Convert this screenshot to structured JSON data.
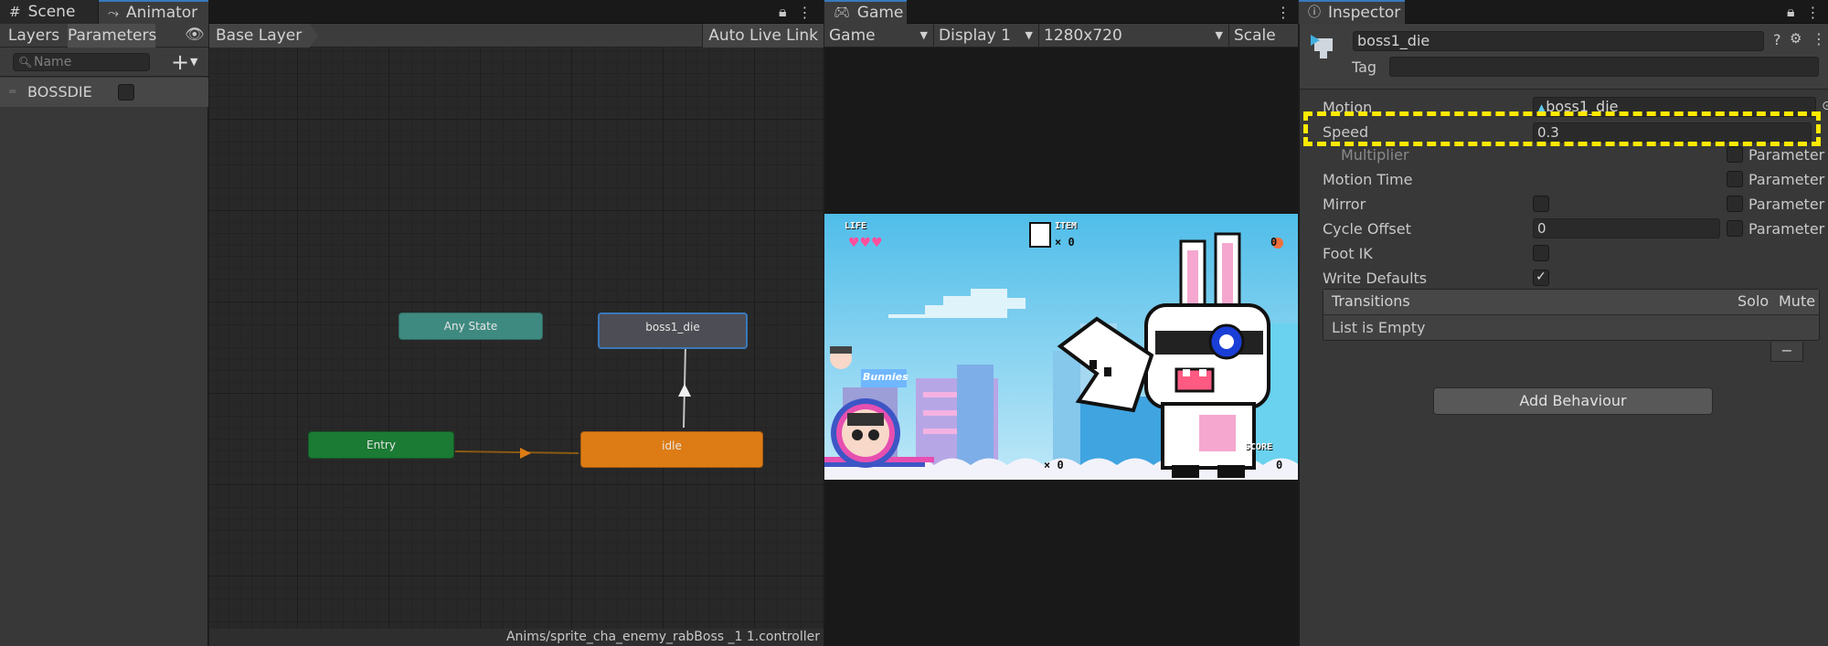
{
  "tabs": {
    "scene": "Scene",
    "animator": "Animator",
    "game": "Game",
    "inspector": "Inspector"
  },
  "animator": {
    "subtabs": {
      "layers": "Layers",
      "parameters": "Parameters"
    },
    "search_placeholder": "Name",
    "parameters": [
      {
        "name": "BOSSDIE",
        "checked": false
      }
    ],
    "breadcrumb": "Base Layer",
    "auto_live_link": "Auto Live Link",
    "nodes": {
      "any_state": "Any State",
      "boss1_die": "boss1_die",
      "entry": "Entry",
      "idle": "idle"
    },
    "controller_path": "Anims/sprite_cha_enemy_rabBoss _1 1.controller",
    "colors": {
      "any_state": "#3f8a80",
      "entry": "#1b7a33",
      "idle": "#dd7c15",
      "selected": "#4d4d55",
      "selected_border": "#3a79bb"
    }
  },
  "game": {
    "mode": "Game",
    "display": "Display 1",
    "resolution": "1280x720",
    "scale_label": "Scale",
    "hud": {
      "life": "LIFE",
      "item": "ITEM",
      "item_count": "× 0",
      "score_top": "0",
      "score": "SCORE",
      "score_value": "0",
      "bottom_count": "× 0",
      "sign": "Bunnies"
    }
  },
  "inspector": {
    "name": "boss1_die",
    "tag_label": "Tag",
    "motion_label": "Motion",
    "motion_value": "boss1_die",
    "speed_label": "Speed",
    "speed_value": "0.3",
    "multiplier_label": "Multiplier",
    "motion_time_label": "Motion Time",
    "mirror_label": "Mirror",
    "cycle_offset_label": "Cycle Offset",
    "cycle_offset_value": "0",
    "foot_ik_label": "Foot IK",
    "write_defaults_label": "Write Defaults",
    "write_defaults_checked": true,
    "parameter_label": "Parameter",
    "transitions_label": "Transitions",
    "solo_label": "Solo",
    "mute_label": "Mute",
    "list_empty": "List is Empty",
    "minus": "−",
    "add_behaviour": "Add Behaviour",
    "highlight_color": "#ffe900"
  }
}
